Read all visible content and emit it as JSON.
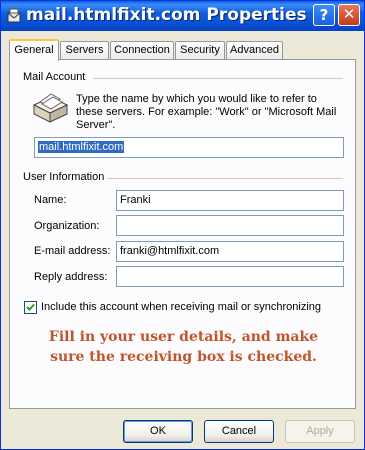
{
  "window": {
    "title": "mail.htmlfixit.com Properties"
  },
  "titlebar": {
    "help_label": "?",
    "close_label": "✕"
  },
  "tabs": [
    {
      "label": "General",
      "active": true
    },
    {
      "label": "Servers",
      "active": false
    },
    {
      "label": "Connection",
      "active": false
    },
    {
      "label": "Security",
      "active": false
    },
    {
      "label": "Advanced",
      "active": false
    }
  ],
  "mail_account": {
    "group_title": "Mail Account",
    "description": "Type the name by which you would like to refer to these servers.  For example: \"Work\" or \"Microsoft Mail Server\".",
    "account_name": "mail.htmlfixit.com"
  },
  "user_information": {
    "group_title": "User Information",
    "fields": [
      {
        "label": "Name:",
        "value": "Franki"
      },
      {
        "label": "Organization:",
        "value": ""
      },
      {
        "label": "E-mail address:",
        "value": "franki@htmlfixit.com"
      },
      {
        "label": "Reply address:",
        "value": ""
      }
    ]
  },
  "include_account": {
    "label": "Include this account when receiving mail or synchronizing",
    "checked": true
  },
  "annotation": {
    "line1": "Fill in your user details, and make",
    "line2": "sure the receiving box is checked."
  },
  "buttons": {
    "ok": "OK",
    "cancel": "Cancel",
    "apply": "Apply"
  },
  "colors": {
    "titlebar": "#0A4ED2",
    "annotation": "#C0552A",
    "face": "#ECE9D8"
  }
}
